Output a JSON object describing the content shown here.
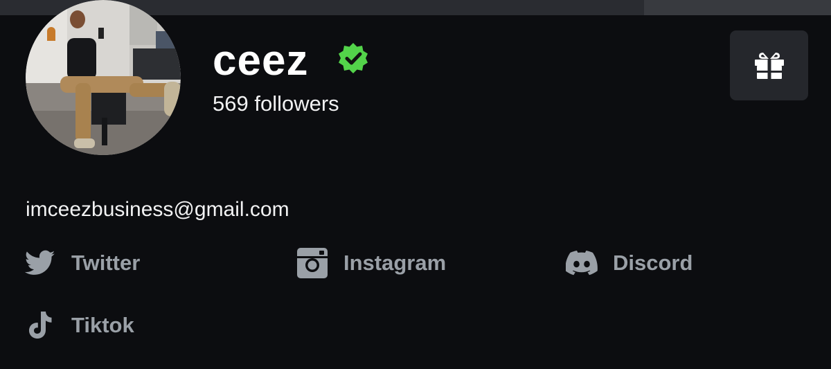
{
  "profile": {
    "username": "ceez",
    "followers": "569 followers",
    "email": "imceezbusiness@gmail.com",
    "verified_icon": "verified-badge-icon",
    "avatar_alt": "profile photo"
  },
  "gift_button": {
    "icon": "gift-icon"
  },
  "socials": [
    {
      "label": "Twitter",
      "icon": "twitter-icon"
    },
    {
      "label": "Instagram",
      "icon": "instagram-icon"
    },
    {
      "label": "Discord",
      "icon": "discord-icon"
    },
    {
      "label": "Tiktok",
      "icon": "tiktok-icon"
    }
  ],
  "colors": {
    "background": "#0c0d10",
    "verified": "#53d34a",
    "social_text": "#9aa0a7",
    "gift_button_bg": "#25272c"
  }
}
